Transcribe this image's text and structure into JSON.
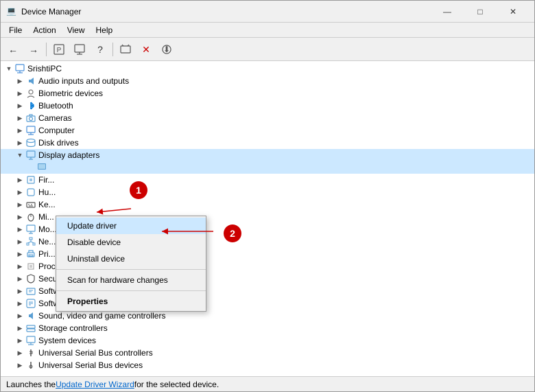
{
  "window": {
    "title": "Device Manager",
    "icon": "💻"
  },
  "menubar": {
    "items": [
      "File",
      "Action",
      "View",
      "Help"
    ]
  },
  "toolbar": {
    "buttons": [
      "←",
      "→",
      "⊞",
      "📋",
      "?",
      "🖥",
      "📤",
      "🔌",
      "✕",
      "⬇"
    ]
  },
  "tree": {
    "root": "SrishtiPC",
    "items": [
      {
        "id": "audio",
        "label": "Audio inputs and outputs",
        "indent": 1,
        "expanded": false,
        "icon": "audio"
      },
      {
        "id": "biometric",
        "label": "Biometric devices",
        "indent": 1,
        "expanded": false,
        "icon": "biometric"
      },
      {
        "id": "bluetooth",
        "label": "Bluetooth",
        "indent": 1,
        "expanded": false,
        "icon": "bluetooth"
      },
      {
        "id": "cameras",
        "label": "Cameras",
        "indent": 1,
        "expanded": false,
        "icon": "camera"
      },
      {
        "id": "computer",
        "label": "Computer",
        "indent": 1,
        "expanded": false,
        "icon": "computer"
      },
      {
        "id": "disk",
        "label": "Disk drives",
        "indent": 1,
        "expanded": false,
        "icon": "disk"
      },
      {
        "id": "display",
        "label": "Display adapters",
        "indent": 1,
        "expanded": true,
        "icon": "display",
        "selected": true
      },
      {
        "id": "display-sub",
        "label": "",
        "indent": 2,
        "icon": "monitor"
      },
      {
        "id": "firmware",
        "label": "Fir...",
        "indent": 1,
        "expanded": false,
        "icon": "fw"
      },
      {
        "id": "hid",
        "label": "Hu...",
        "indent": 1,
        "expanded": false,
        "icon": "hid"
      },
      {
        "id": "keyboard",
        "label": "Ke...",
        "indent": 1,
        "expanded": false,
        "icon": "keyboard"
      },
      {
        "id": "mice",
        "label": "Mi...",
        "indent": 1,
        "expanded": false,
        "icon": "mouse"
      },
      {
        "id": "monitors",
        "label": "Mo...",
        "indent": 1,
        "expanded": false,
        "icon": "monitor2"
      },
      {
        "id": "network",
        "label": "Ne...",
        "indent": 1,
        "expanded": false,
        "icon": "network"
      },
      {
        "id": "printers",
        "label": "Pri...",
        "indent": 1,
        "expanded": false,
        "icon": "printer"
      },
      {
        "id": "processors",
        "label": "Processors",
        "indent": 1,
        "expanded": false,
        "icon": "processor"
      },
      {
        "id": "security",
        "label": "Security devices",
        "indent": 1,
        "expanded": false,
        "icon": "security"
      },
      {
        "id": "software-components",
        "label": "Software components",
        "indent": 1,
        "expanded": false,
        "icon": "software"
      },
      {
        "id": "software-devices",
        "label": "Software devices",
        "indent": 1,
        "expanded": false,
        "icon": "software"
      },
      {
        "id": "sound",
        "label": "Sound, video and game controllers",
        "indent": 1,
        "expanded": false,
        "icon": "sound"
      },
      {
        "id": "storage",
        "label": "Storage controllers",
        "indent": 1,
        "expanded": false,
        "icon": "storage"
      },
      {
        "id": "system",
        "label": "System devices",
        "indent": 1,
        "expanded": false,
        "icon": "system"
      },
      {
        "id": "usb",
        "label": "Universal Serial Bus controllers",
        "indent": 1,
        "expanded": false,
        "icon": "usb"
      },
      {
        "id": "usb-devices",
        "label": "Universal Serial Bus devices",
        "indent": 1,
        "expanded": false,
        "icon": "usb"
      }
    ]
  },
  "context_menu": {
    "items": [
      {
        "id": "update",
        "label": "Update driver",
        "bold": false,
        "selected": true
      },
      {
        "id": "disable",
        "label": "Disable device",
        "bold": false
      },
      {
        "id": "uninstall",
        "label": "Uninstall device",
        "bold": false
      },
      {
        "id": "sep",
        "type": "separator"
      },
      {
        "id": "scan",
        "label": "Scan for hardware changes",
        "bold": false
      },
      {
        "id": "sep2",
        "type": "separator"
      },
      {
        "id": "properties",
        "label": "Properties",
        "bold": true
      }
    ]
  },
  "annotations": {
    "circle1": "1",
    "circle2": "2"
  },
  "status_bar": {
    "text": "Launches the ",
    "link": "Update Driver Wizard",
    "text2": " for the selected device."
  }
}
